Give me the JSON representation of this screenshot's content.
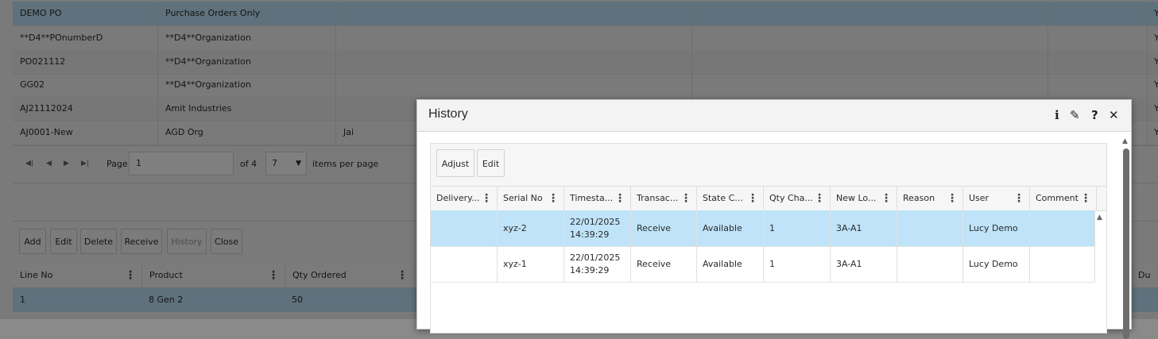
{
  "purchase_orders": {
    "rows": [
      {
        "po": "DEMO PO",
        "org": "Purchase Orders Only",
        "c3": "",
        "end": "Y",
        "selected": true
      },
      {
        "po": "**D4**POnumberD",
        "org": "**D4**Organization",
        "c3": "",
        "end": "Y",
        "selected": false
      },
      {
        "po": "PO021112",
        "org": "**D4**Organization",
        "c3": "",
        "end": "Y",
        "selected": false
      },
      {
        "po": "GG02",
        "org": "**D4**Organization",
        "c3": "",
        "end": "Y",
        "selected": false
      },
      {
        "po": "AJ21112024",
        "org": "Amit Industries",
        "c3": "",
        "end": "Y",
        "selected": false
      },
      {
        "po": "AJ0001-New",
        "org": "AGD Org",
        "c3": "Jai",
        "end": "Y",
        "selected": false
      }
    ]
  },
  "pager": {
    "page_label": "Page",
    "page_value": "1",
    "of_label": "of 4",
    "page_size": "7",
    "items_per_page": "items per page"
  },
  "actions": {
    "add": "Add",
    "edit": "Edit",
    "delete": "Delete",
    "receive": "Receive",
    "history": "History",
    "close": "Close"
  },
  "lines": {
    "headers": [
      "Line No",
      "Product",
      "Qty Ordered"
    ],
    "end_header": "Du",
    "row": {
      "line_no": "1",
      "product": "8 Gen 2",
      "qty": "50"
    }
  },
  "dialog": {
    "title": "History",
    "toolbar": {
      "adjust": "Adjust",
      "edit": "Edit"
    },
    "columns": [
      "Delivery...",
      "Serial No",
      "Timesta...",
      "Transac...",
      "State C...",
      "Qty Cha...",
      "New Lo...",
      "Reason",
      "User",
      "Comment"
    ],
    "rows": [
      {
        "delivery": "",
        "serial": "xyz-2",
        "timestamp": "22/01/2025\n14:39:29",
        "transaction": "Receive",
        "state": "Available",
        "qty": "1",
        "location": "3A-A1",
        "reason": "",
        "user": "Lucy Demo",
        "comment": "",
        "selected": true
      },
      {
        "delivery": "",
        "serial": "xyz-1",
        "timestamp": "22/01/2025\n14:39:29",
        "transaction": "Receive",
        "state": "Available",
        "qty": "1",
        "location": "3A-A1",
        "reason": "",
        "user": "Lucy Demo",
        "comment": "",
        "selected": false
      }
    ]
  },
  "icons": {
    "info": "info-icon",
    "edit": "pencil-icon",
    "help": "help-icon",
    "close": "close-icon"
  },
  "colors": {
    "selected_row": "#bfe3f8",
    "overlay": "rgba(0,0,0,0.5)"
  }
}
